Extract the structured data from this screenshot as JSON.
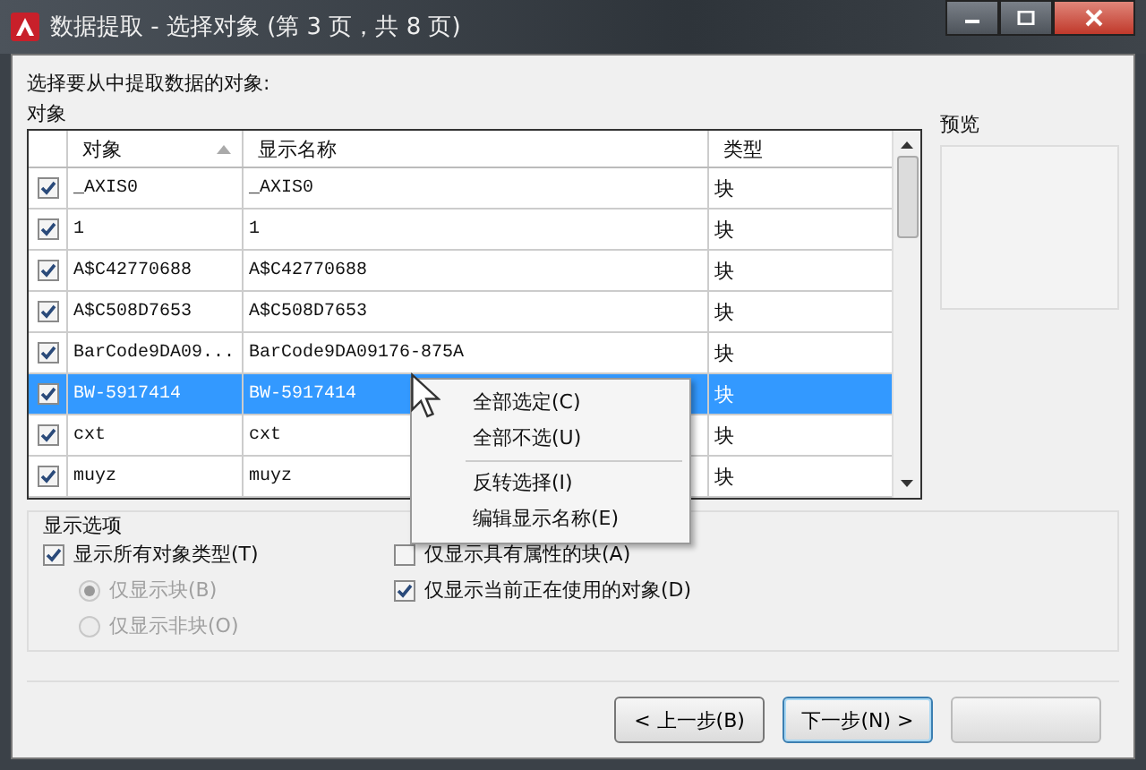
{
  "window": {
    "title": "数据提取 - 选择对象 (第 3 页，共 8 页)"
  },
  "prompt": "选择要从中提取数据的对象:",
  "objects_group": {
    "title": "对象",
    "columns": [
      {
        "label": "对象",
        "sorted": true
      },
      {
        "label": "显示名称",
        "sorted": false
      },
      {
        "label": "类型",
        "sorted": false
      }
    ],
    "rows": [
      {
        "checked": true,
        "selected": false,
        "object": "_AXIS0",
        "display_name": "_AXIS0",
        "type": "块"
      },
      {
        "checked": true,
        "selected": false,
        "object": "1",
        "display_name": "1",
        "type": "块"
      },
      {
        "checked": true,
        "selected": false,
        "object": "A$C42770688",
        "display_name": "A$C42770688",
        "type": "块"
      },
      {
        "checked": true,
        "selected": false,
        "object": "A$C508D7653",
        "display_name": "A$C508D7653",
        "type": "块"
      },
      {
        "checked": true,
        "selected": false,
        "object": "BarCode9DA09...",
        "display_name": "BarCode9DA09176-875A",
        "type": "块"
      },
      {
        "checked": true,
        "selected": true,
        "object": "BW-5917414",
        "display_name": "BW-5917414",
        "type": "块"
      },
      {
        "checked": true,
        "selected": false,
        "object": "cxt",
        "display_name": "cxt",
        "type": "块"
      },
      {
        "checked": true,
        "selected": false,
        "object": "muyz",
        "display_name": "muyz",
        "type": "块"
      }
    ]
  },
  "preview": {
    "title": "预览"
  },
  "context_menu": [
    {
      "label": "全部选定(C)",
      "kind": "item"
    },
    {
      "label": "全部不选(U)",
      "kind": "item"
    },
    {
      "kind": "separator"
    },
    {
      "label": "反转选择(I)",
      "kind": "item"
    },
    {
      "label": "编辑显示名称(E)",
      "kind": "item"
    }
  ],
  "display_options": {
    "title": "显示选项",
    "left": [
      {
        "kind": "checkbox",
        "label": "显示所有对象类型(T)",
        "checked": true,
        "disabled": false
      },
      {
        "kind": "radio",
        "label": "仅显示块(B)",
        "selected": true,
        "disabled": true
      },
      {
        "kind": "radio",
        "label": "仅显示非块(O)",
        "selected": false,
        "disabled": true
      }
    ],
    "right": [
      {
        "kind": "checkbox",
        "label": "仅显示具有属性的块(A)",
        "checked": false,
        "disabled": false
      },
      {
        "kind": "checkbox",
        "label": "仅显示当前正在使用的对象(D)",
        "checked": true,
        "disabled": false
      }
    ]
  },
  "buttons": [
    {
      "label": "< 上一步(B)",
      "focused": false
    },
    {
      "label": "下一步(N) >",
      "focused": true
    }
  ]
}
